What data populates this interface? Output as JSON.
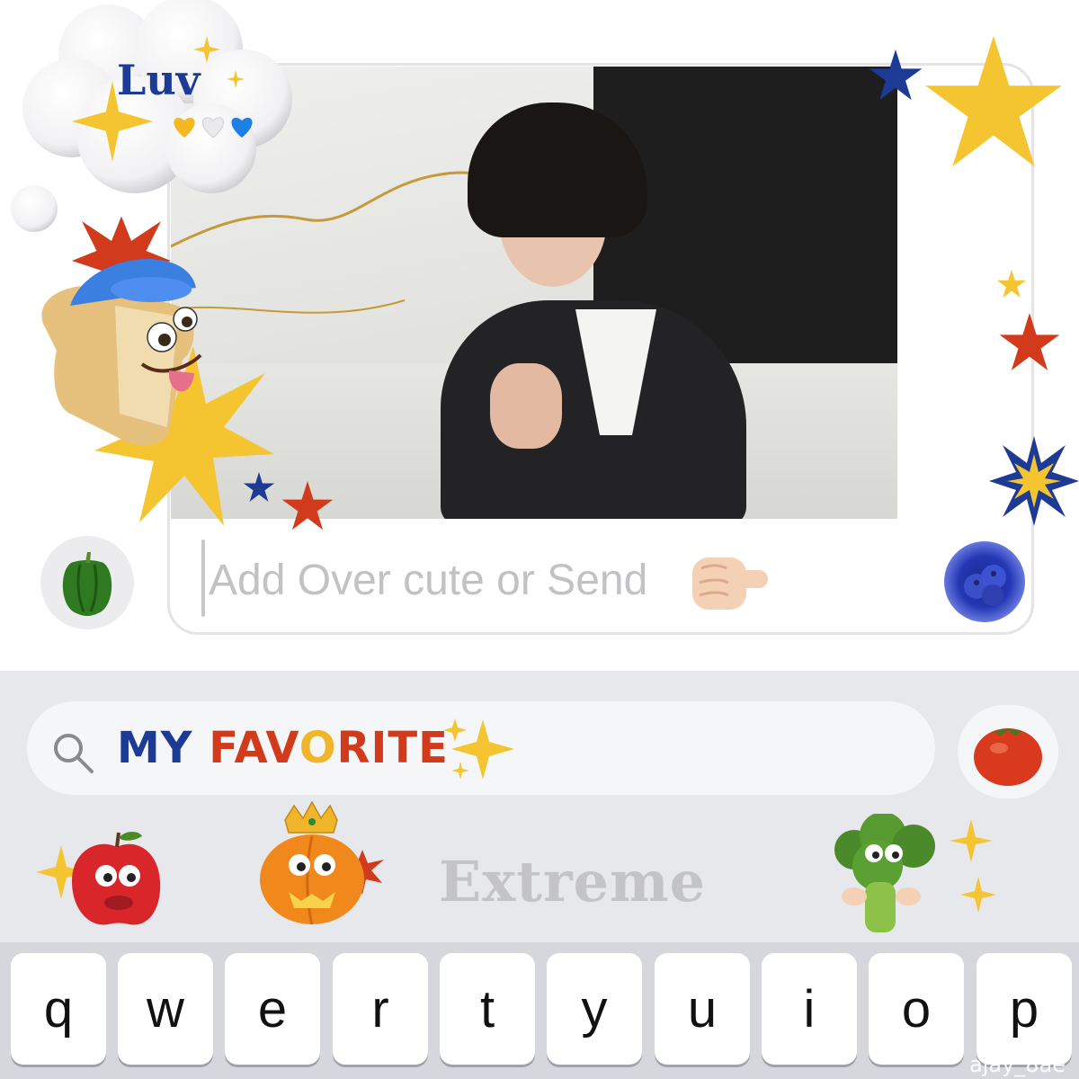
{
  "message": {
    "placeholder": "Add Over cute or Send"
  },
  "bubble": {
    "text": "Luv"
  },
  "emoji_search": {
    "query_parts": [
      {
        "text": "MY ",
        "color": "#1d3a94"
      },
      {
        "text": "FAV",
        "color": "#d23a1c"
      },
      {
        "text": "O",
        "color": "#f0b52a"
      },
      {
        "text": "RITE",
        "color": "#d23a1c"
      }
    ]
  },
  "label": {
    "text": "Extreme"
  },
  "keyboard": {
    "row1": [
      "q",
      "w",
      "e",
      "r",
      "t",
      "y",
      "u",
      "i",
      "o",
      "p"
    ]
  },
  "watermark": "ajay_8ae",
  "icons": [
    "search-icon",
    "bell-pepper-icon",
    "blueberries-icon",
    "tomato-icon",
    "pointing-hand-icon",
    "sparkles-icon",
    "apple-face-icon",
    "pumpkin-king-icon",
    "broccoli-face-icon",
    "bread-face-icon",
    "star-icon",
    "heart-icon"
  ],
  "colors": {
    "brand_blue": "#1d3a94",
    "brand_red": "#d23a1c",
    "brand_yellow": "#f5c531"
  }
}
